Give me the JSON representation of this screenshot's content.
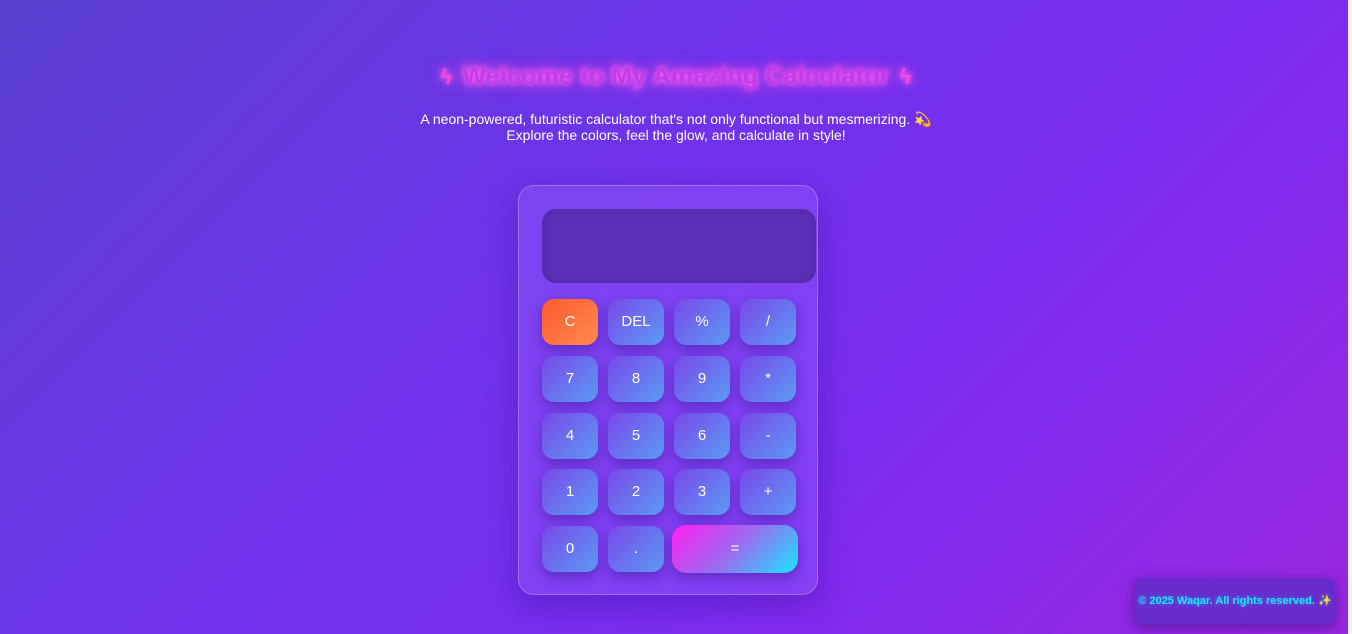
{
  "header": {
    "title": "Welcome to My Amazing Calculator",
    "title_icon": "lightning-bolt",
    "subtitle_line1": "A neon-powered, futuristic calculator that's not only functional but mesmerizing. 💫",
    "subtitle_line2": "Explore the colors, feel the glow, and calculate in style!"
  },
  "calculator": {
    "display_value": "",
    "keys": {
      "clear": "C",
      "del": "DEL",
      "percent": "%",
      "divide": "/",
      "seven": "7",
      "eight": "8",
      "nine": "9",
      "multiply": "*",
      "four": "4",
      "five": "5",
      "six": "6",
      "subtract": "-",
      "one": "1",
      "two": "2",
      "three": "3",
      "add": "+",
      "zero": "0",
      "decimal": ".",
      "equals": "="
    }
  },
  "footer": {
    "text": "© 2025 Waqar. All rights reserved. ✨"
  },
  "colors": {
    "clear_key": "#ff5a2d",
    "equals_start": "#ff1ff0",
    "equals_end": "#19e6ff",
    "footer_text": "#22e4ff",
    "title_glow": "#ff4fd8"
  }
}
